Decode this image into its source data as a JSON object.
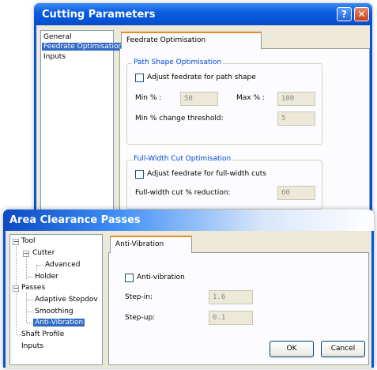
{
  "cutting": {
    "title": "Cutting Parameters",
    "help_icon": "help-question-icon",
    "close_icon": "close-x-icon",
    "nav": [
      "General",
      "Feedrate Optimisation",
      "Inputs"
    ],
    "tab": "Feedrate Optimisation",
    "group1": {
      "legend": "Path Shape Optimisation",
      "checkbox": "Adjust feedrate for path shape",
      "min_label": "Min % :",
      "min_value": "50",
      "max_label": "Max % :",
      "max_value": "100",
      "threshold_label": "Min % change threshold:",
      "threshold_value": "5"
    },
    "group2": {
      "legend": "Full-Width Cut Optimisation",
      "checkbox": "Adjust feedrate for full-width cuts",
      "reduction_label": "Full-width cut % reduction:",
      "reduction_value": "60"
    }
  },
  "area": {
    "title": "Area Clearance Passes",
    "tree": {
      "tool": "Tool",
      "cutter": "Cutter",
      "advanced": "Advanced",
      "holder": "Holder",
      "passes": "Passes",
      "adaptive": "Adaptive Stepdov",
      "smoothing": "Smoothing",
      "anti_vibration": "Anti-Vibration",
      "shaft": "Shaft Profile",
      "inputs": "Inputs"
    },
    "tab": "Anti-Vibration",
    "checkbox": "Anti-vibration",
    "stepin_label": "Step-in:",
    "stepin_value": "1.6",
    "stepup_label": "Step-up:",
    "stepup_value": "0.1",
    "ok": "OK",
    "cancel": "Cancel"
  }
}
